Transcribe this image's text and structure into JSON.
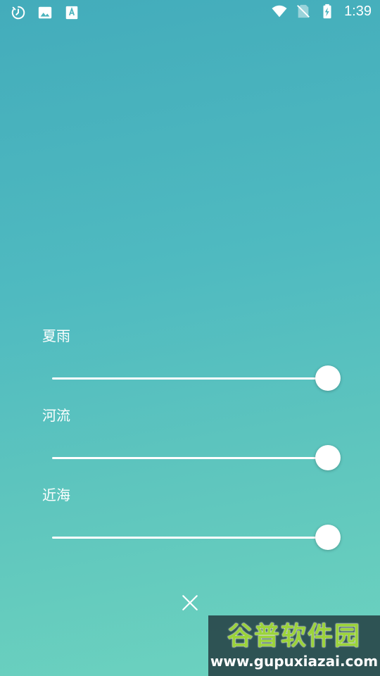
{
  "status_bar": {
    "time": "1:39",
    "left_icons": [
      "timer-icon",
      "image-icon",
      "font-icon"
    ],
    "right_icons": [
      "wifi-icon",
      "no-sim-icon",
      "battery-charging-icon"
    ]
  },
  "sliders": [
    {
      "label": "夏雨",
      "value": 1.0
    },
    {
      "label": "河流",
      "value": 1.0
    },
    {
      "label": "近海",
      "value": 1.0
    }
  ],
  "close": {
    "icon": "close-icon"
  },
  "watermark": {
    "cn": "谷普软件园",
    "url": "www.gupuxiazai.com"
  },
  "colors": {
    "bg_top": "#43acbb",
    "bg_bottom": "#6dd3bf",
    "track": "#ffffff",
    "thumb": "#ffffff",
    "watermark_green": "#9bd33a"
  }
}
